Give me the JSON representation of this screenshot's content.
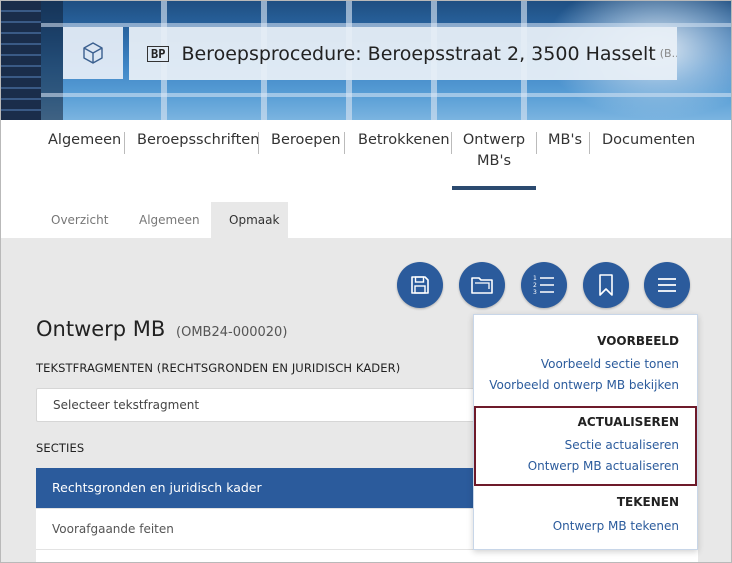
{
  "header": {
    "badge": "BP",
    "title": "Beroepsprocedure: Beroepsstraat 2, 3500 Hasselt",
    "subtitle": "(B..."
  },
  "tabs": [
    {
      "label": "Algemeen"
    },
    {
      "label": "Beroepsschriften"
    },
    {
      "label": "Beroepen"
    },
    {
      "label": "Betrokkenen"
    },
    {
      "label": "Ontwerp",
      "label2": "MB's",
      "active": true
    },
    {
      "label": "MB's"
    },
    {
      "label": "Documenten"
    }
  ],
  "subtabs": [
    {
      "label": "Overzicht"
    },
    {
      "label": "Algemeen"
    },
    {
      "label": "Opmaak",
      "active": true
    }
  ],
  "toolbar": {
    "icons": [
      "save-icon",
      "folder-icon",
      "numbered-list-icon",
      "bookmark-icon",
      "menu-icon"
    ]
  },
  "main": {
    "title": "Ontwerp MB",
    "code": "(OMB24-000020)",
    "fragments_label": "TEKSTFRAGMENTEN (RECHTSGRONDEN EN JURIDISCH KADER)",
    "select_placeholder": "Selecteer tekstfragment",
    "sections_label": "SECTIES",
    "sections": [
      {
        "label": "Rechtsgronden en juridisch kader",
        "active": true
      },
      {
        "label": "Voorafgaande feiten"
      },
      {
        "label": ""
      }
    ]
  },
  "menu": {
    "voorbeeld_head": "VOORBEELD",
    "voorbeeld_sectie": "Voorbeeld sectie tonen",
    "voorbeeld_ontwerp": "Voorbeeld ontwerp MB bekijken",
    "actualiseren_head": "ACTUALISEREN",
    "sectie_actualiseren": "Sectie actualiseren",
    "ontwerp_actualiseren": "Ontwerp MB actualiseren",
    "tekenen_head": "TEKENEN",
    "ontwerp_tekenen": "Ontwerp MB tekenen"
  },
  "colors": {
    "primary": "#2b5b9c",
    "highlight_border": "#6e1a2a"
  }
}
